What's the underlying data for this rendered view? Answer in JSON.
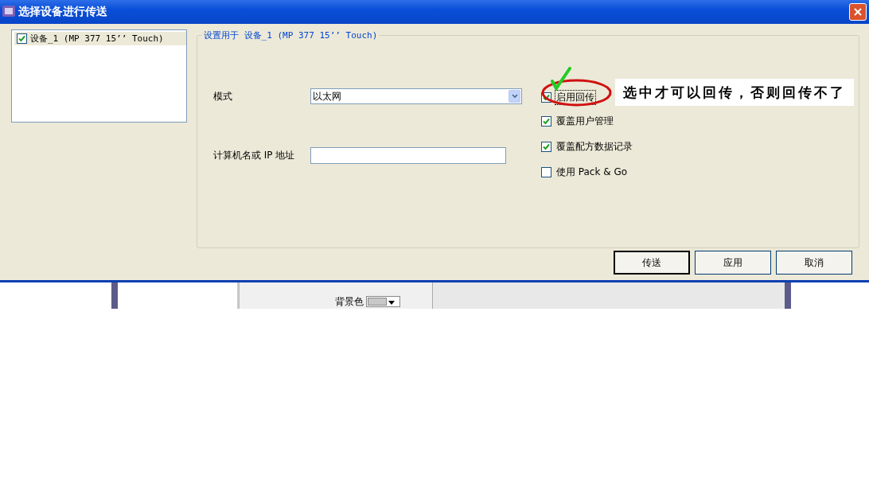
{
  "window": {
    "title": "选择设备进行传送"
  },
  "device_list": [
    {
      "label": "设备_1 (MP 377 15’’ Touch)",
      "checked": true,
      "selected": true
    }
  ],
  "settings": {
    "title": "设置用于 设备_1 (MP 377 15’’ Touch)",
    "mode_label": "模式",
    "mode_value": "以太网",
    "address_label": "计算机名或 IP 地址",
    "options": [
      {
        "label": "启用回传",
        "checked": true,
        "focused": true
      },
      {
        "label": "覆盖用户管理",
        "checked": true,
        "focused": false
      },
      {
        "label": "覆盖配方数据记录",
        "checked": true,
        "focused": false
      },
      {
        "label": "使用 Pack & Go",
        "checked": false,
        "focused": false
      }
    ]
  },
  "annotation": {
    "note": "选中才可以回传，否则回传不了"
  },
  "buttons": [
    {
      "label": "传送",
      "default": true
    },
    {
      "label": "应用",
      "default": false
    },
    {
      "label": "取消",
      "default": false
    }
  ],
  "background_window": {
    "color_label": "背景色"
  }
}
